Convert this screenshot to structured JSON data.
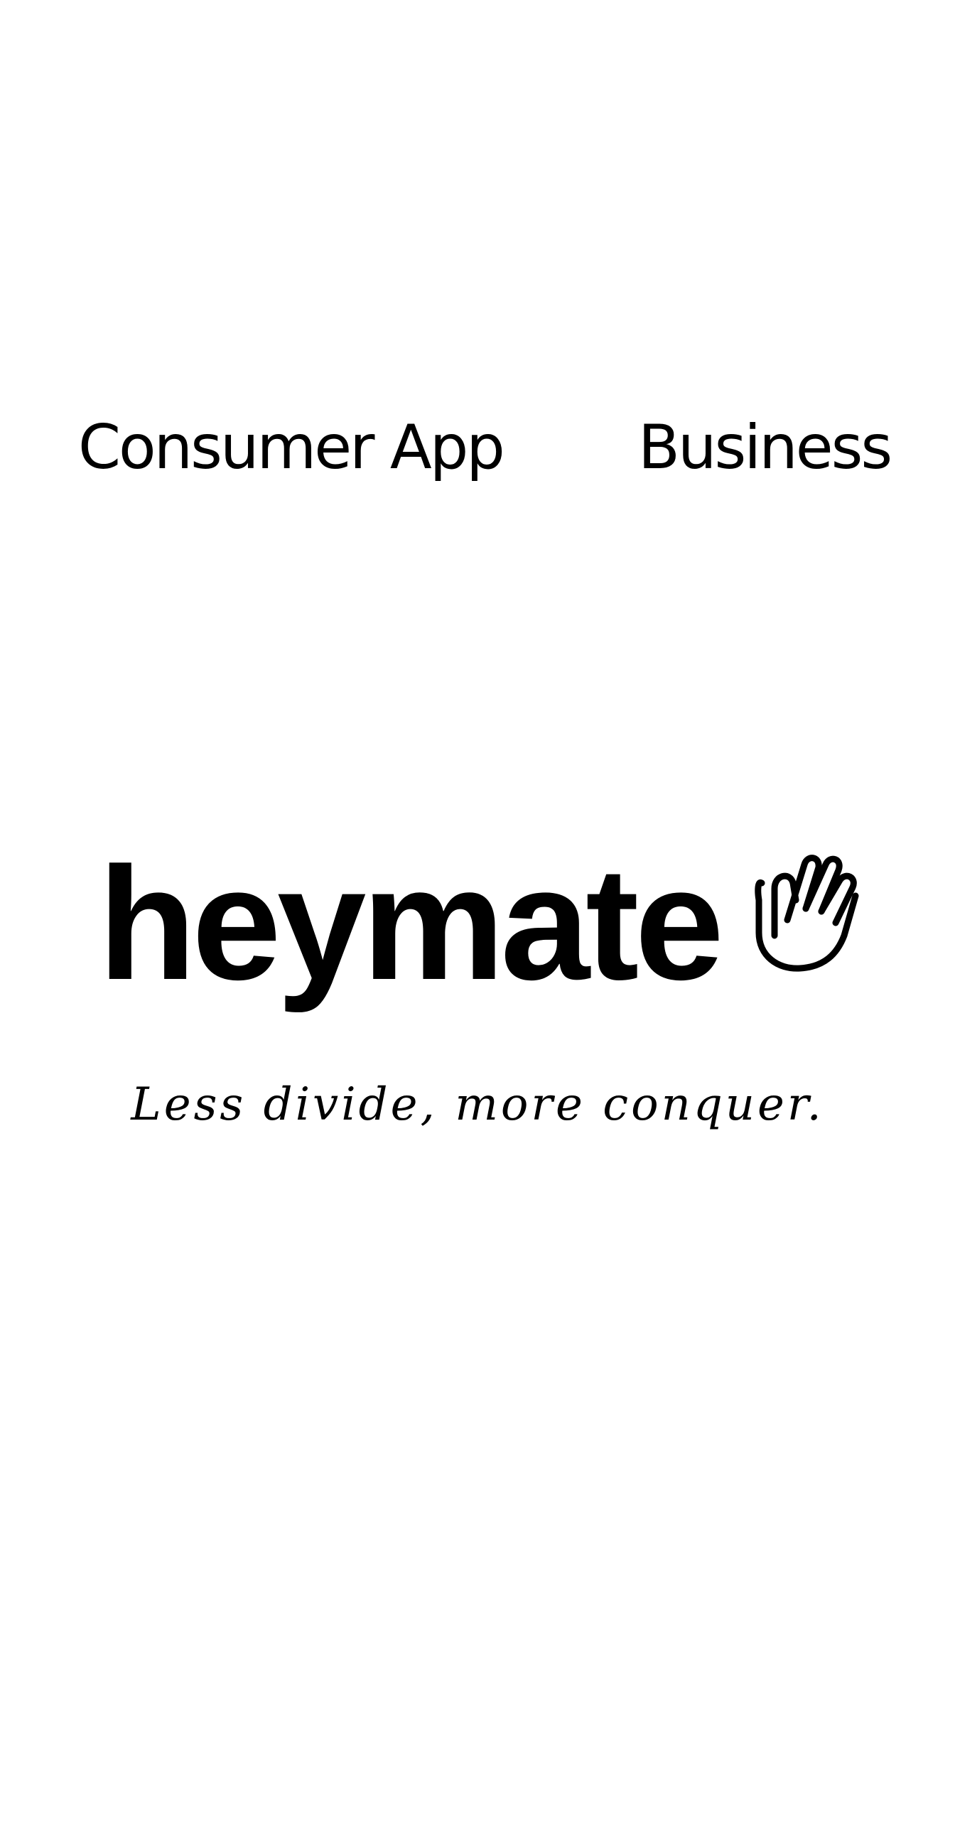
{
  "nav": {
    "consumer_label": "Consumer App",
    "business_label": "Business"
  },
  "brand": {
    "name": "heymate",
    "icon": "waving-hand-icon",
    "tagline": "Less divide, more conquer."
  },
  "colors": {
    "background": "#ffffff",
    "text": "#000000"
  }
}
